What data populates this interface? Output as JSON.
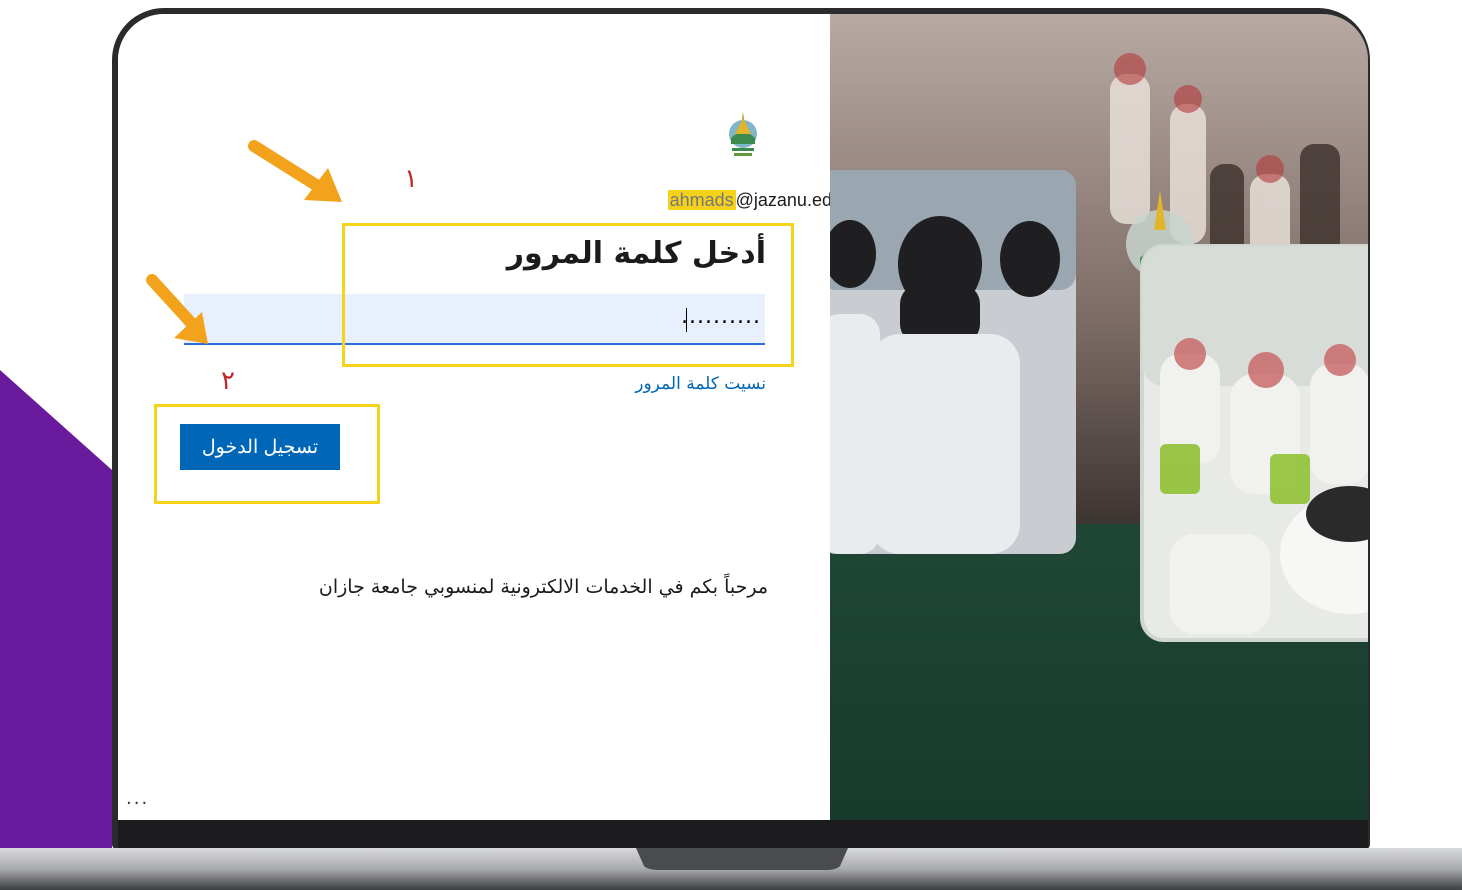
{
  "login": {
    "email_user": "ahmads",
    "email_domain": "@jazanu.edu.sa",
    "back_arrow": "→",
    "heading": "أدخل كلمة المرور",
    "password_mask": "..........",
    "forgot_password": "نسيت كلمة المرور",
    "signin_label": "تسجيل الدخول",
    "welcome_text": "مرحباً بكم في الخدمات الالكترونية لمنسوبي جامعة جازان",
    "more_options": "..."
  },
  "annotations": {
    "step1": "١",
    "step2": "٢",
    "highlight_color": "#f6d21a",
    "arrow_color": "#f2a31b",
    "step_color": "#c22727"
  },
  "colors": {
    "button": "#0067b8",
    "link": "#0067b8",
    "input_bg": "#e8f0fe",
    "brand_purple": "#6a1a9c",
    "panel_green": "#1f4a3a"
  },
  "icons": [
    "university-logo-icon",
    "arrow-right-icon"
  ]
}
